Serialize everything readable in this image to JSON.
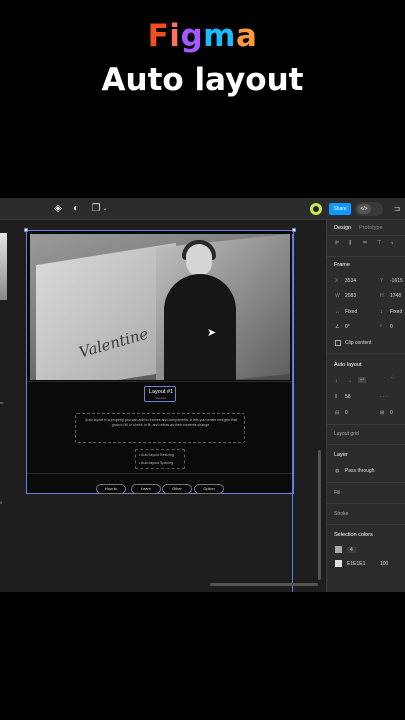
{
  "header": {
    "brand_letters": [
      {
        "ch": "F",
        "color": "#f24e1e"
      },
      {
        "ch": "i",
        "color": "#ff7262"
      },
      {
        "ch": "g",
        "color": "#a259ff"
      },
      {
        "ch": "m",
        "color": "#1abcfe"
      },
      {
        "ch": "a",
        "color": "#ff9a3c"
      }
    ],
    "subtitle": "Auto layout"
  },
  "toolbar": {
    "share_label": "Share",
    "code_label": "</>",
    "icons": [
      "component-icon",
      "contrast-icon",
      "layers-icon",
      "chevron-down-icon",
      "avatar",
      "panel-toggle-icon"
    ]
  },
  "canvas": {
    "valentine": "Valentine",
    "layout_title": "Layout #1",
    "layout_sub": "purposes",
    "description": "Auto layout is a property you can add to frames and components. It lets you create designs that grow to fill or shrink to fit, and reflow as their contents change.",
    "list": [
      "• Auto layout Resizing",
      "• Auto layout Spacing"
    ],
    "pills": [
      "How-to",
      "Learn",
      "Other",
      "Option"
    ],
    "left_fragments": [
      "m.",
      "0"
    ],
    "frame_color": "#6b7fe0"
  },
  "panel": {
    "tabs": [
      "Design",
      "Prototype"
    ],
    "frame_section": "Frame",
    "x_label": "X",
    "x_val": "3534",
    "y_label": "Y",
    "y_val": "-1615",
    "w_label": "W",
    "w_val": "2083",
    "h_label": "H",
    "h_val": "1748",
    "w_mode": "Fixed",
    "h_mode": "Fixed",
    "rotation": "0°",
    "radius": "0",
    "clip_label": "Clip content",
    "auto_layout_section": "Auto layout",
    "gap_val": "58",
    "pad_val": "0",
    "pad2_val": "0",
    "layout_grid": "Layout grid",
    "layer_section": "Layer",
    "blend_mode": "Pass through",
    "fill_label": "Fill",
    "stroke_label": "Stroke",
    "selection_colors": "Selection colors",
    "sel_color_1": "4",
    "sel_color_2": "E1E1E1",
    "sel_color_2_opacity": "100"
  }
}
